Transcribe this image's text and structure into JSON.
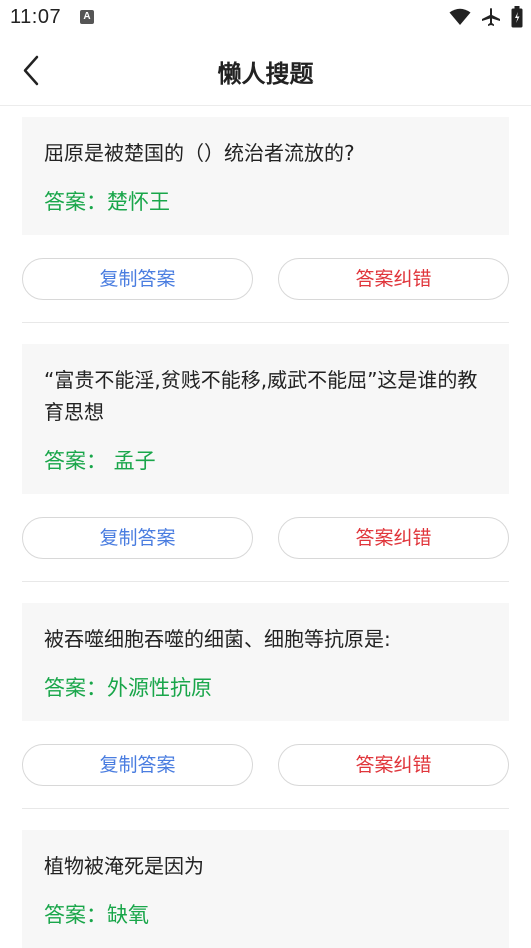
{
  "status_bar": {
    "time": "11:07",
    "a_badge": "A",
    "icons": [
      "wifi-icon",
      "airplane-icon",
      "battery-icon"
    ]
  },
  "nav": {
    "title": "懒人搜题",
    "back_icon": "chevron-left-icon"
  },
  "colors": {
    "answer": "#19a64a",
    "copy_button": "#4a7de0",
    "fix_button": "#e0353b",
    "card_bg": "#f7f7f7"
  },
  "items": [
    {
      "question": "屈原是被楚国的（）统治者流放的?",
      "answer": "答案：楚怀王",
      "copy_label": "复制答案",
      "fix_label": "答案纠错"
    },
    {
      "question": "“富贵不能淫,贫贱不能移,威武不能屈”这是谁的教育思想",
      "answer": "答案： 孟子",
      "copy_label": "复制答案",
      "fix_label": "答案纠错"
    },
    {
      "question": "被吞噬细胞吞噬的细菌、细胞等抗原是:",
      "answer": "答案：外源性抗原",
      "copy_label": "复制答案",
      "fix_label": "答案纠错"
    },
    {
      "question": "植物被淹死是因为",
      "answer": "答案：缺氧"
    }
  ]
}
